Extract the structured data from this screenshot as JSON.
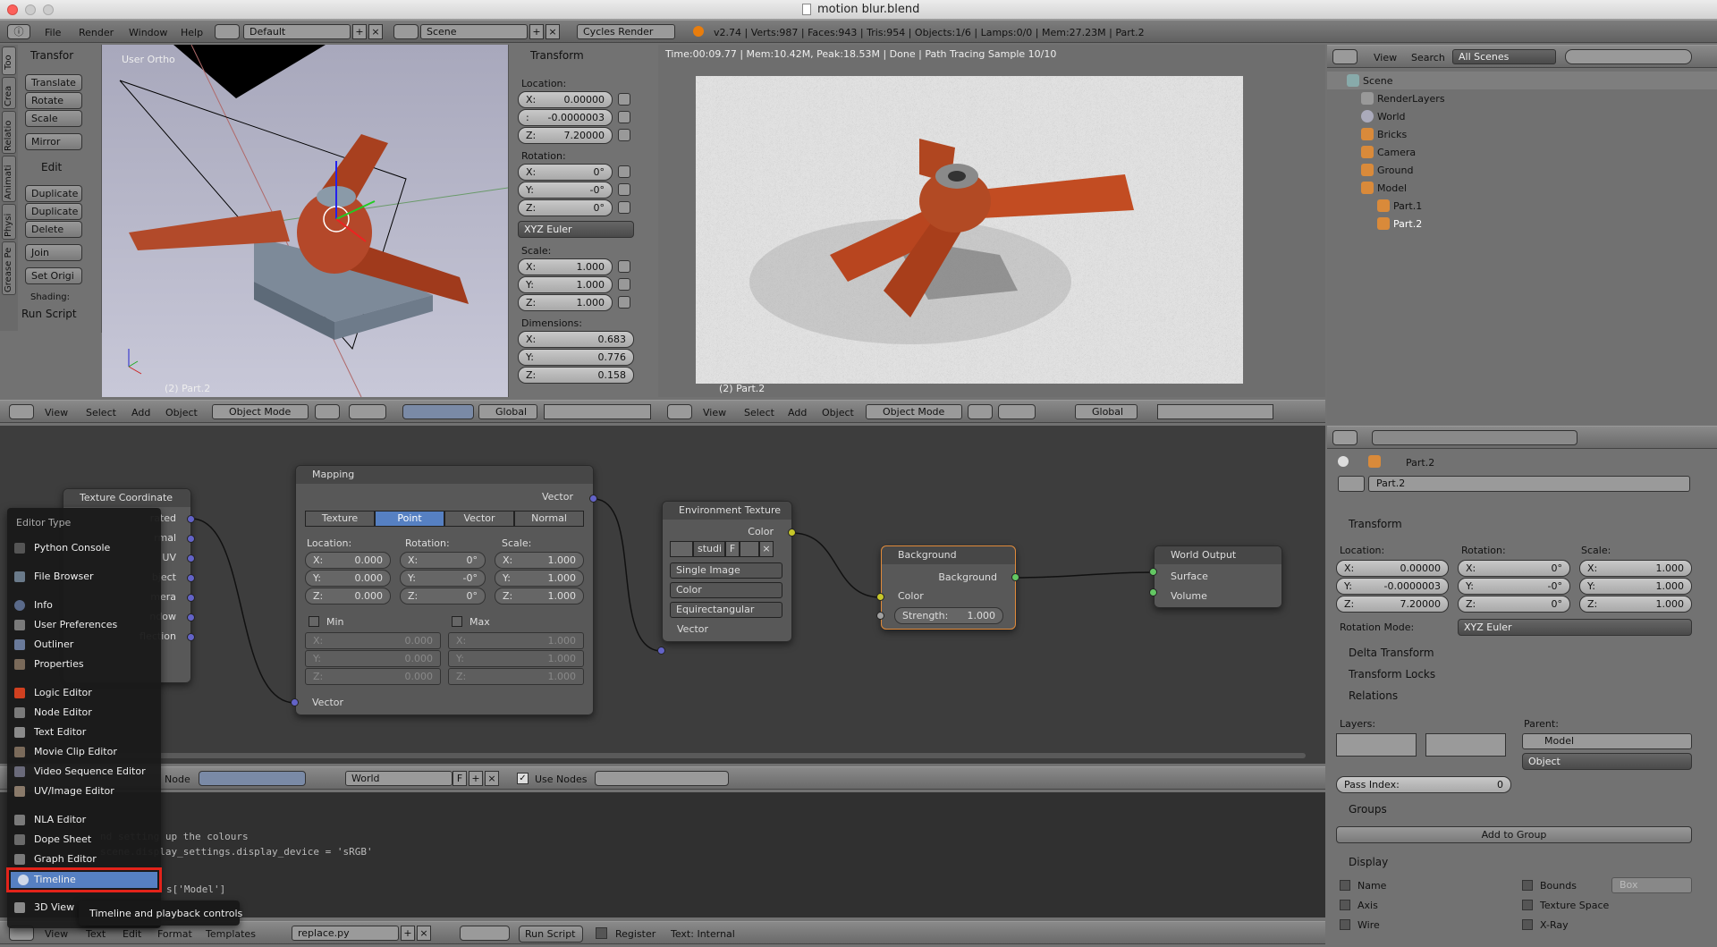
{
  "window": {
    "title": "motion blur.blend"
  },
  "topbar": {
    "menus": [
      "File",
      "Render",
      "Window",
      "Help"
    ],
    "layout": "Default",
    "scene": "Scene",
    "engine": "Cycles Render",
    "stats": "v2.74 | Verts:987 | Faces:943 | Tris:954 | Objects:1/6 | Lamps:0/0 | Mem:27.23M | Part.2"
  },
  "toolshelf": {
    "tabs": [
      "Too",
      "Crea",
      "Relatio",
      "Animati",
      "Physi",
      "Grease Pe"
    ],
    "transform_label": "Transfor",
    "transform_buttons": [
      "Translate",
      "Rotate",
      "Scale",
      "Mirror"
    ],
    "edit_label": "Edit",
    "edit_buttons": [
      "Duplicate",
      "Duplicate",
      "Delete",
      "Join",
      "Set Origi"
    ],
    "shading_label": "Shading:",
    "run_script": "Run Script"
  },
  "viewport_left": {
    "view_label": "User Ortho",
    "object_label": "(2) Part.2"
  },
  "n_panel": {
    "header": "Transform",
    "location_label": "Location:",
    "location": [
      {
        "axis": "X:",
        "value": "0.00000"
      },
      {
        "axis": ":",
        "value": "-0.0000003"
      },
      {
        "axis": "Z:",
        "value": "7.20000"
      }
    ],
    "rotation_label": "Rotation:",
    "rotation": [
      {
        "axis": "X:",
        "value": "0°"
      },
      {
        "axis": "Y:",
        "value": "-0°"
      },
      {
        "axis": "Z:",
        "value": "0°"
      }
    ],
    "rotation_mode": "XYZ Euler",
    "scale_label": "Scale:",
    "scale": [
      {
        "axis": "X:",
        "value": "1.000"
      },
      {
        "axis": "Y:",
        "value": "1.000"
      },
      {
        "axis": "Z:",
        "value": "1.000"
      }
    ],
    "dimensions_label": "Dimensions:",
    "dimensions": [
      {
        "axis": "X:",
        "value": "0.683"
      },
      {
        "axis": "Y:",
        "value": "0.776"
      },
      {
        "axis": "Z:",
        "value": "0.158"
      }
    ]
  },
  "view3d_header_left": {
    "menus": [
      "View",
      "Select",
      "Add",
      "Object"
    ],
    "mode": "Object Mode",
    "orientation": "Global"
  },
  "viewport_right": {
    "render_info": "Time:00:09.77 | Mem:10.42M, Peak:18.53M | Done | Path Tracing Sample 10/10",
    "object_label": "(2) Part.2"
  },
  "view3d_header_right": {
    "menus": [
      "View",
      "Select",
      "Add",
      "Object"
    ],
    "mode": "Object Mode",
    "orientation": "Global"
  },
  "outliner": {
    "header_menus": [
      "View",
      "Search"
    ],
    "scope": "All Scenes",
    "items": [
      {
        "label": "Scene"
      },
      {
        "label": "RenderLayers"
      },
      {
        "label": "World"
      },
      {
        "label": "Bricks"
      },
      {
        "label": "Camera"
      },
      {
        "label": "Ground"
      },
      {
        "label": "Model"
      },
      {
        "label": "Part.1"
      },
      {
        "label": "Part.2"
      }
    ]
  },
  "nodes": {
    "texcoord": {
      "title": "Texture Coordinate",
      "outputs": [
        "rated",
        "rmal",
        "UV",
        "bject",
        "mera",
        "ndow",
        "flection"
      ]
    },
    "mapping": {
      "title": "Mapping",
      "output": "Vector",
      "tabs": [
        "Texture",
        "Point",
        "Vector",
        "Normal"
      ],
      "location_label": "Location:",
      "rotation_label": "Rotation:",
      "scale_label": "Scale:",
      "location": [
        {
          "axis": "X:",
          "value": "0.000"
        },
        {
          "axis": "Y:",
          "value": "0.000"
        },
        {
          "axis": "Z:",
          "value": "0.000"
        }
      ],
      "rotation": [
        {
          "axis": "X:",
          "value": "0°"
        },
        {
          "axis": "Y:",
          "value": "-0°"
        },
        {
          "axis": "Z:",
          "value": "0°"
        }
      ],
      "scale": [
        {
          "axis": "X:",
          "value": "1.000"
        },
        {
          "axis": "Y:",
          "value": "1.000"
        },
        {
          "axis": "Z:",
          "value": "1.000"
        }
      ],
      "min_label": "Min",
      "max_label": "Max",
      "min": [
        {
          "axis": "X:",
          "value": "0.000"
        },
        {
          "axis": "Y:",
          "value": "0.000"
        },
        {
          "axis": "Z:",
          "value": "0.000"
        }
      ],
      "max": [
        {
          "axis": "X:",
          "value": "1.000"
        },
        {
          "axis": "Y:",
          "value": "1.000"
        },
        {
          "axis": "Z:",
          "value": "1.000"
        }
      ],
      "input": "Vector"
    },
    "envtex": {
      "title": "Environment Texture",
      "output": "Color",
      "image": "studi",
      "f": "F",
      "source": "Single Image",
      "color_space": "Color",
      "projection": "Equirectangular",
      "input": "Vector"
    },
    "background": {
      "title": "Background",
      "output": "Background",
      "color": "Color",
      "strength_label": "Strength:",
      "strength": "1.000"
    },
    "world_output": {
      "title": "World Output",
      "surface": "Surface",
      "volume": "Volume"
    }
  },
  "node_header": {
    "node_menu": "Node",
    "world": "World",
    "f": "F",
    "use_nodes": "Use Nodes"
  },
  "text_editor": {
    "lines": [
      "nd setting up the colours",
      "scene.display_settings.display_device = 'sRGB'",
      "s['Model']"
    ],
    "menus": [
      "View",
      "Text",
      "Edit",
      "Format",
      "Templates"
    ],
    "filename": "replace.py",
    "run_script": "Run Script",
    "register": "Register",
    "internal": "Text: Internal"
  },
  "editor_menu": {
    "title": "Editor Type",
    "items": [
      {
        "label": "Python Console",
        "color": "#555"
      },
      {
        "label": "File Browser",
        "color": "#6a7a8a"
      },
      {
        "label": "Info",
        "color": "#5a6a8a"
      },
      {
        "label": "User Preferences",
        "color": "#7a7a7a"
      },
      {
        "label": "Outliner",
        "color": "#6a7a9a"
      },
      {
        "label": "Properties",
        "color": "#7a6a5a"
      },
      {
        "label": "Logic Editor",
        "color": "#d04020"
      },
      {
        "label": "Node Editor",
        "color": "#7a7a7a"
      },
      {
        "label": "Text Editor",
        "color": "#8a8a8a"
      },
      {
        "label": "Movie Clip Editor",
        "color": "#7a6a5a"
      },
      {
        "label": "Video Sequence Editor",
        "color": "#6a6a7a"
      },
      {
        "label": "UV/Image Editor",
        "color": "#8a7a6a"
      },
      {
        "label": "NLA Editor",
        "color": "#7a7a7a"
      },
      {
        "label": "Dope Sheet",
        "color": "#6a6a6a"
      },
      {
        "label": "Graph Editor",
        "color": "#7a7a7a"
      },
      {
        "label": "Timeline",
        "color": "#5a7ab0"
      },
      {
        "label": "3D View",
        "color": "#8a8a8a"
      }
    ],
    "tooltip": "Timeline and playback controls"
  },
  "properties": {
    "object_name": "Part.2",
    "breadcrumb": "Part.2",
    "transform_header": "Transform",
    "location_label": "Location:",
    "rotation_label": "Rotation:",
    "scale_label": "Scale:",
    "location": [
      {
        "axis": "X:",
        "value": "0.00000"
      },
      {
        "axis": "Y:",
        "value": "-0.0000003"
      },
      {
        "axis": "Z:",
        "value": "7.20000"
      }
    ],
    "rotation": [
      {
        "axis": "X:",
        "value": "0°"
      },
      {
        "axis": "Y:",
        "value": "-0°"
      },
      {
        "axis": "Z:",
        "value": "0°"
      }
    ],
    "scale": [
      {
        "axis": "X:",
        "value": "1.000"
      },
      {
        "axis": "Y:",
        "value": "1.000"
      },
      {
        "axis": "Z:",
        "value": "1.000"
      }
    ],
    "rotation_mode_label": "Rotation Mode:",
    "rotation_mode": "XYZ Euler",
    "delta_transform": "Delta Transform",
    "transform_locks": "Transform Locks",
    "relations": "Relations",
    "layers_label": "Layers:",
    "parent_label": "Parent:",
    "parent": "Model",
    "parent_type": "Object",
    "pass_index_label": "Pass Index:",
    "pass_index": "0",
    "groups": "Groups",
    "add_to_group": "Add to Group",
    "display": "Display",
    "display_left": [
      "Name",
      "Axis",
      "Wire"
    ],
    "display_right": [
      "Bounds",
      "Texture Space",
      "X-Ray"
    ],
    "bounds_type": "Box"
  }
}
